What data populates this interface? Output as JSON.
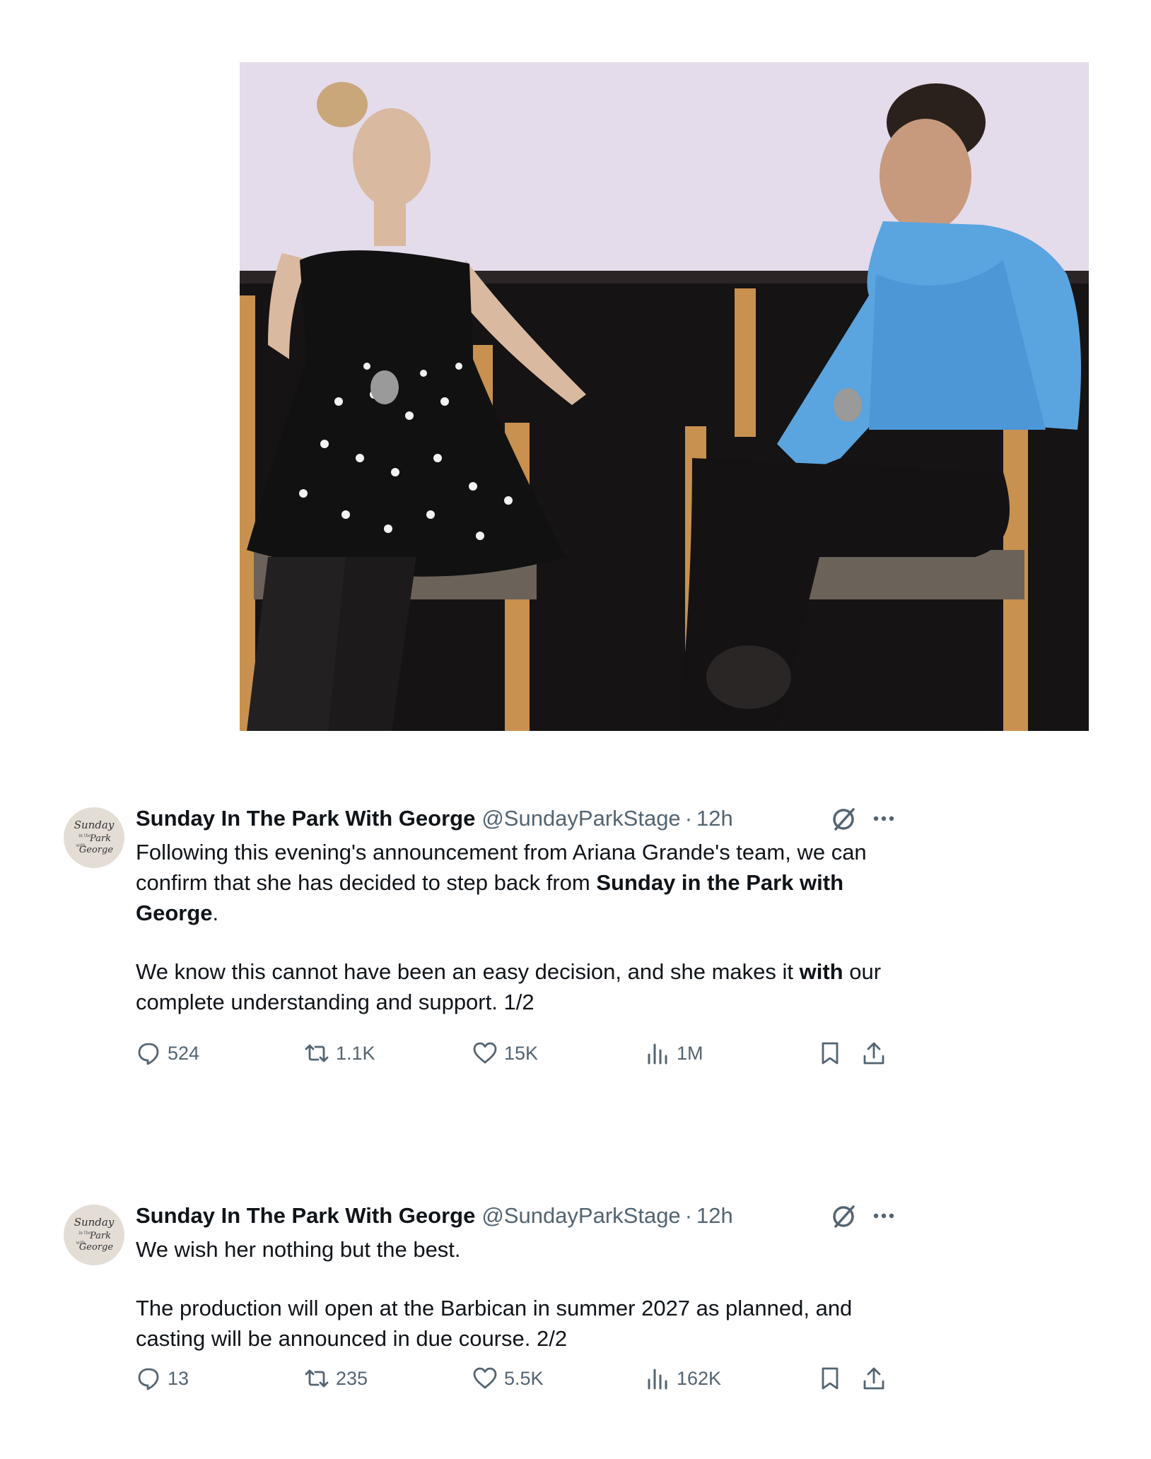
{
  "photo": {
    "description_icon": "event-photo"
  },
  "tweets": [
    {
      "avatar_text": "Sunday in the Park with George",
      "name": "Sunday In The Park With George",
      "handle": "@SundayParkStage",
      "separator": "·",
      "time": "12h",
      "para1_part1": "Following this evening's announcement from Ariana Grande's team, we can confirm that she has decided to step back from ",
      "para1_bold": "Sunday in the Park with George",
      "para1_part2": ".",
      "para2_part1": "We know this cannot have been an easy decision, and she makes it ",
      "para2_bold": "with",
      "para2_part2": " our complete understanding and support. 1/2",
      "replies": "524",
      "retweets": "1.1K",
      "likes": "15K",
      "views": "1M"
    },
    {
      "avatar_text": "Sunday in the Park with George",
      "name": "Sunday In The Park With George",
      "handle": "@SundayParkStage",
      "separator": "·",
      "time": "12h",
      "para1": "We wish her nothing but the best.",
      "para2": "The production will open at the Barbican in summer 2027 as planned, and casting will be announced in due course. 2/2",
      "replies": "13",
      "retweets": "235",
      "likes": "5.5K",
      "views": "162K"
    }
  ],
  "icons": {
    "reply": "reply-icon",
    "retweet": "retweet-icon",
    "like": "heart-icon",
    "views": "views-icon",
    "bookmark": "bookmark-icon",
    "share": "share-icon",
    "grok": "grok-icon",
    "more": "more-icon"
  }
}
